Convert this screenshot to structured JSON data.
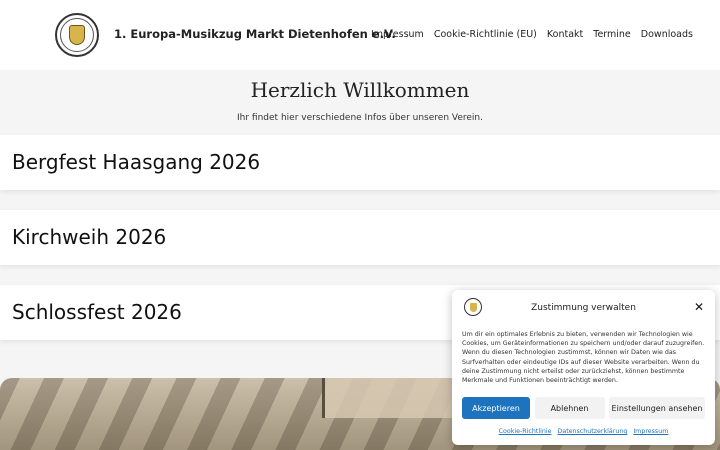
{
  "header": {
    "site_title": "1. Europa-Musikzug Markt Dietenhofen e.V.",
    "nav": [
      "Impressum",
      "Cookie-Richtlinie (EU)",
      "Kontakt",
      "Termine",
      "Downloads"
    ]
  },
  "welcome": {
    "title": "Herzlich Willkommen",
    "subtitle": "Ihr findet hier verschiedene Infos über unseren Verein."
  },
  "events": [
    "Bergfest Haasgang 2026",
    "Kirchweih 2026",
    "Schlossfest 2026"
  ],
  "consent": {
    "title": "Zustimmung verwalten",
    "text": "Um dir ein optimales Erlebnis zu bieten, verwenden wir Technologien wie Cookies, um Geräteinformationen zu speichern und/oder darauf zuzugreifen. Wenn du diesen Technologien zustimmst, können wir Daten wie das Surfverhalten oder eindeutige IDs auf dieser Website verarbeiten. Wenn du deine Zustimmung nicht erteilst oder zurückziehst, können bestimmte Merkmale und Funktionen beeinträchtigt werden.",
    "accept": "Akzeptieren",
    "deny": "Ablehnen",
    "settings": "Einstellungen ansehen",
    "links": [
      "Cookie-Richtlinie",
      "Datenschutzerklärung",
      "Impressum"
    ]
  },
  "colors": {
    "accent": "#1e73be",
    "background": "#f5f5f5"
  }
}
